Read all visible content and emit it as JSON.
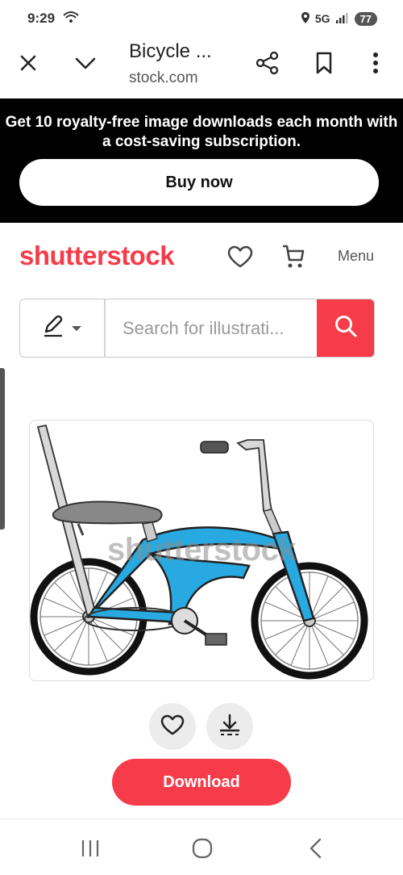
{
  "status_bar": {
    "time": "9:29",
    "network": "5G",
    "battery": "77"
  },
  "browser": {
    "title": "Bicycle ...",
    "url": "stock.com"
  },
  "promo": {
    "text_line1": "Get 10 royalty-free image downloads each month with",
    "text_line2": "a cost-saving subscription.",
    "buy_label": "Buy now"
  },
  "header": {
    "logo": "shutterstock",
    "menu_label": "Menu"
  },
  "search": {
    "placeholder": "Search for illustrati..."
  },
  "image": {
    "watermark": "shutterstock"
  },
  "actions": {
    "download_label": "Download"
  },
  "colors": {
    "brand": "#f63c4a",
    "bike_frame": "#29a9e1"
  }
}
